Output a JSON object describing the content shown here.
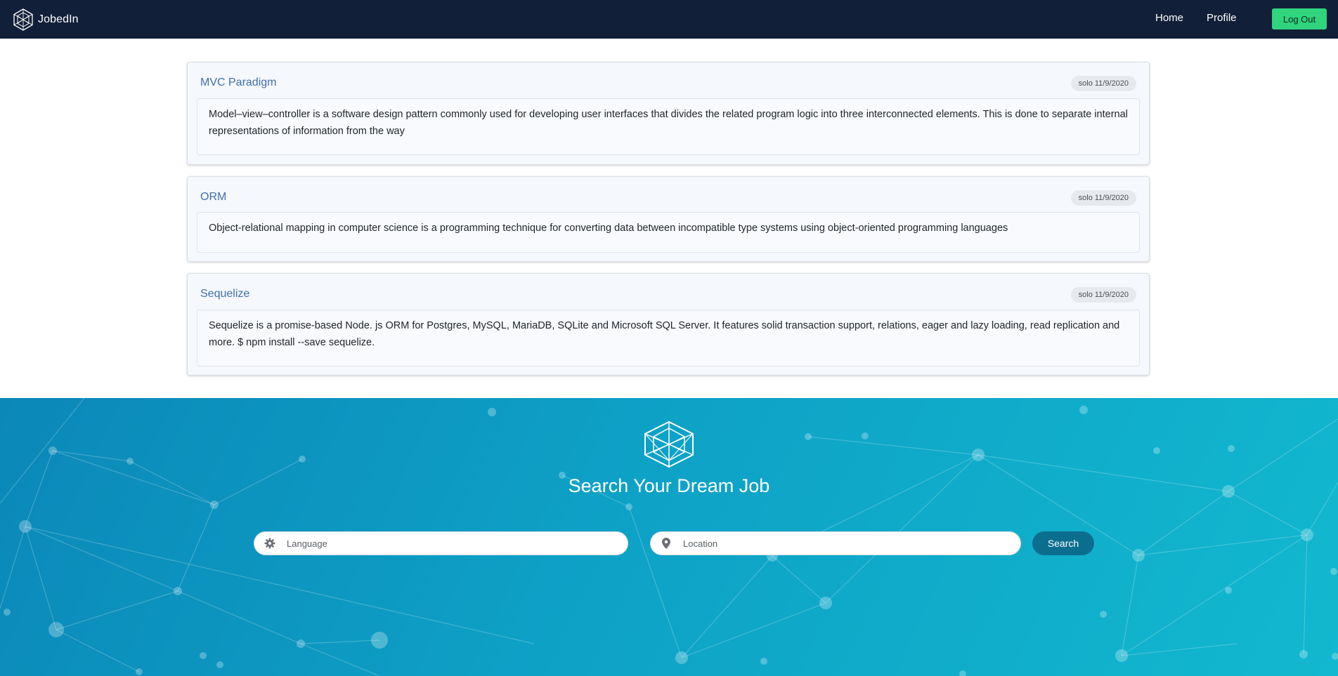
{
  "navbar": {
    "brand": "JobedIn",
    "home": "Home",
    "profile": "Profile",
    "logout": "Log Out"
  },
  "posts": [
    {
      "title": "MVC Paradigm",
      "meta": "solo 11/9/2020",
      "body": "Model–view–controller is a software design pattern commonly used for developing user interfaces that divides the related program logic into three interconnected elements. This is done to separate internal representations of information from the way"
    },
    {
      "title": "ORM",
      "meta": "solo 11/9/2020",
      "body": "Object-relational mapping in computer science is a programming technique for converting data between incompatible type systems using object-oriented programming languages"
    },
    {
      "title": "Sequelize",
      "meta": "solo 11/9/2020",
      "body": "Sequelize is a promise-based Node. js ORM for Postgres, MySQL, MariaDB, SQLite and Microsoft SQL Server. It features solid transaction support, relations, eager and lazy loading, read replication and more. $ npm install --save sequelize."
    }
  ],
  "hero": {
    "title": "Search Your Dream Job",
    "language_placeholder": "Language",
    "location_placeholder": "Location",
    "search_button": "Search"
  },
  "icons": {
    "brand": "hexagon-logo-icon",
    "language": "gear-icon",
    "location": "map-pin-icon"
  },
  "colors": {
    "navbar": "#121f38",
    "logout_button": "#2fd47d",
    "title_link": "#3f6fb0",
    "hero_start": "#0b88b8",
    "hero_end": "#12b8cf",
    "search_button": "#0c6e8f"
  }
}
